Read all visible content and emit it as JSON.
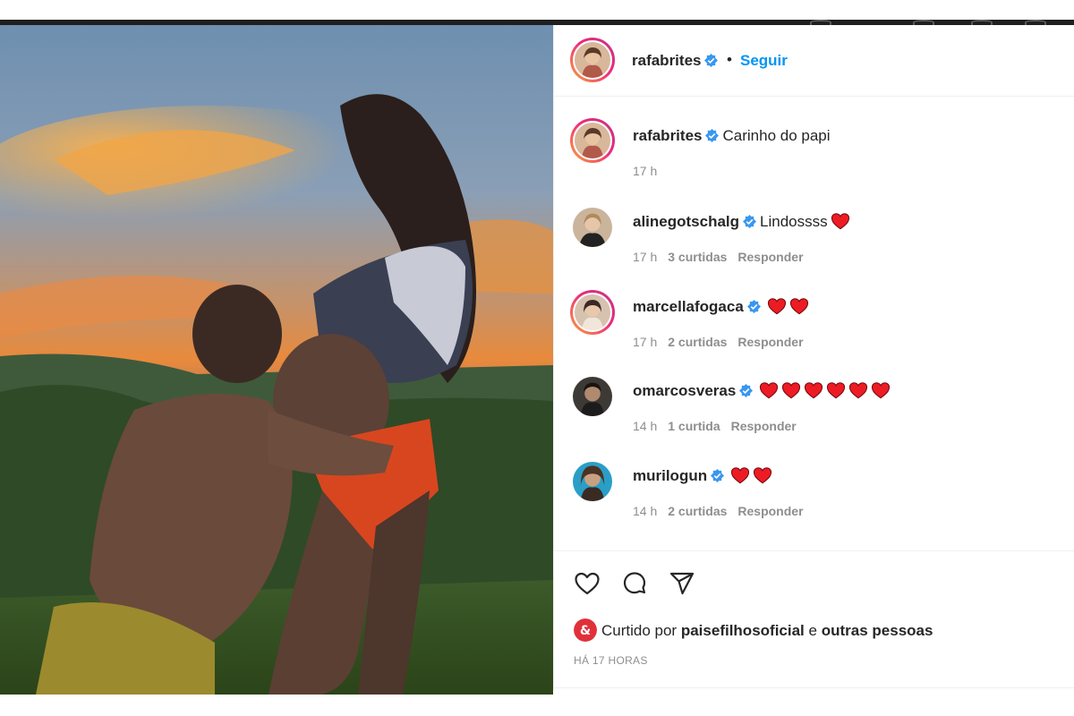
{
  "post": {
    "author": "rafabrites",
    "follow_label": "Seguir",
    "separator": "•"
  },
  "caption": {
    "user": "rafabrites",
    "text": "Carinho do papi",
    "time": "17 h"
  },
  "comments": [
    {
      "user": "alinegotschalg",
      "text": "Lindossss",
      "hearts": 1,
      "time": "17 h",
      "likes": "3 curtidas",
      "reply": "Responder"
    },
    {
      "user": "marcellafogaca",
      "text": "",
      "hearts": 2,
      "time": "17 h",
      "likes": "2 curtidas",
      "reply": "Responder"
    },
    {
      "user": "omarcosveras",
      "text": "",
      "hearts": 6,
      "time": "14 h",
      "likes": "1 curtida",
      "reply": "Responder"
    },
    {
      "user": "murilogun",
      "text": "",
      "hearts": 2,
      "time": "14 h",
      "likes": "2 curtidas",
      "reply": "Responder"
    }
  ],
  "actions": {
    "like_icon": "heart-outline-icon",
    "comment_icon": "comment-bubble-icon",
    "share_icon": "paper-plane-icon"
  },
  "likes_line": {
    "prefix": "Curtido por",
    "liker": "paisefilhosoficial",
    "conjunction": "e",
    "others": "outras pessoas"
  },
  "timestamp": "HÁ 17 HORAS",
  "colors": {
    "link_blue": "#0095f6",
    "verified_blue": "#3897f0",
    "heart_red": "#ed1c24",
    "meta_gray": "#8e8e8e",
    "text_dark": "#262626"
  }
}
